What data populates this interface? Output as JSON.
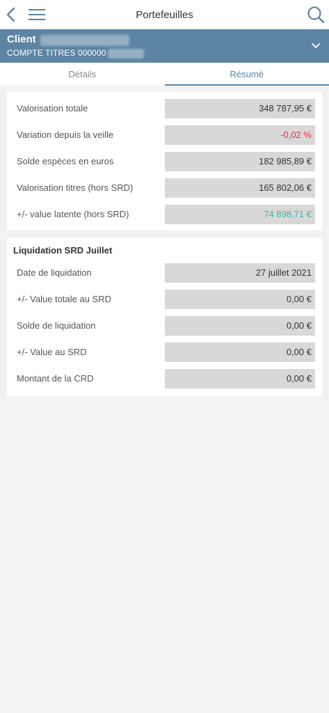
{
  "header": {
    "title": "Portefeuilles"
  },
  "account": {
    "client_label": "Client",
    "account_text": "COMPTE TITRES 000000"
  },
  "tabs": [
    {
      "label": "Détails"
    },
    {
      "label": "Résumé"
    }
  ],
  "summary": [
    {
      "label": "Valorisation totale",
      "value": "348 787,95 €"
    },
    {
      "label": "Variation depuis la veille",
      "value": "-0,02 %"
    },
    {
      "label": "Solde espèces en euros",
      "value": "182 985,89 €"
    },
    {
      "label": "Valorisation titres (hors SRD)",
      "value": "165 802,06 €"
    },
    {
      "label": "+/- value latente (hors SRD)",
      "value": "74 898,71 €"
    }
  ],
  "liquidation": {
    "title": "Liquidation SRD Juillet",
    "rows": [
      {
        "label": "Date de liquidation",
        "value": "27 juillet 2021"
      },
      {
        "label": "+/- Value totale au SRD",
        "value": "0,00 €"
      },
      {
        "label": "Solde de liquidation",
        "value": "0,00 €"
      },
      {
        "label": "+/- Value au SRD",
        "value": "0,00 €"
      },
      {
        "label": "Montant de la CRD",
        "value": "0,00 €"
      }
    ]
  },
  "colors": {
    "accent": "#5c84a3",
    "negative": "#e8303a",
    "positive": "#3db5a0"
  },
  "icons": {
    "back": "chevron-left-icon",
    "menu": "hamburger-menu-icon",
    "search": "search-icon",
    "expand": "chevron-down-icon"
  }
}
